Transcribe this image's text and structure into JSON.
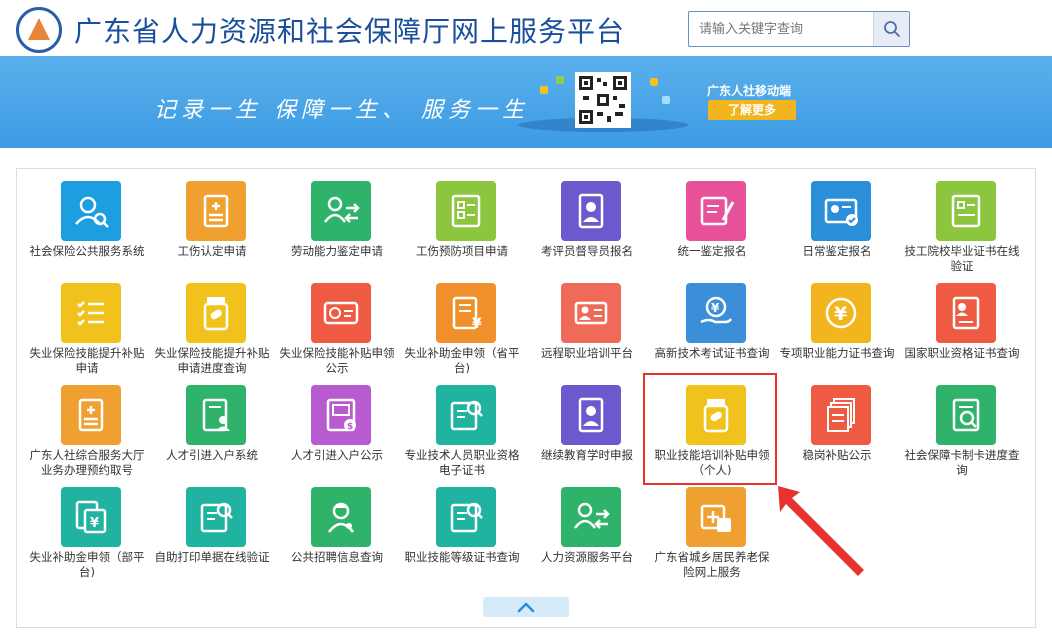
{
  "header": {
    "title": "广东省人力资源和社会保障厅网上服务平台",
    "search_placeholder": "请输入关键字查询"
  },
  "banner": {
    "slogan": "记录一生  保障一生、  服务一生",
    "mobile_label": "广东人社移动端",
    "more_button": "了解更多"
  },
  "colors": {
    "brand_blue": "#1a4f9c",
    "banner_blue": "#4aa4e8",
    "highlight_red": "#e8322d"
  },
  "tiles": [
    {
      "label": "社会保险公共服务系统",
      "color": "#1d9ee0",
      "icon": "user-search-icon"
    },
    {
      "label": "工伤认定申请",
      "color": "#f0a030",
      "icon": "document-plus-icon"
    },
    {
      "label": "劳动能力鉴定申请",
      "color": "#2fb36b",
      "icon": "users-transfer-icon"
    },
    {
      "label": "工伤预防项目申请",
      "color": "#8cc63f",
      "icon": "form-board-icon"
    },
    {
      "label": "考评员督导员报名",
      "color": "#6a5acd",
      "icon": "id-person-icon"
    },
    {
      "label": "统一鉴定报名",
      "color": "#e8509a",
      "icon": "edit-form-icon"
    },
    {
      "label": "日常鉴定报名",
      "color": "#2a8fd8",
      "icon": "id-card-check-icon"
    },
    {
      "label": "技工院校毕业证书在线验证",
      "color": "#8cc63f",
      "icon": "certificate-board-icon"
    },
    {
      "label": "失业保险技能提升补贴申请",
      "color": "#f2c21c",
      "icon": "checklist-icon"
    },
    {
      "label": "失业保险技能提升补贴申请进度查询",
      "color": "#f2c21c",
      "icon": "pill-bottle-icon"
    },
    {
      "label": "失业保险技能补贴申领公示",
      "color": "#ef5a42",
      "icon": "money-card-icon"
    },
    {
      "label": "失业补助金申领（省平台)",
      "color": "#f0902a",
      "icon": "yuan-document-icon"
    },
    {
      "label": "远程职业培训平台",
      "color": "#f06a5a",
      "icon": "person-card-icon"
    },
    {
      "label": "高新技术考试证书查询",
      "color": "#3a8fd8",
      "icon": "yuan-hand-icon"
    },
    {
      "label": "专项职业能力证书查询",
      "color": "#f2b51d",
      "icon": "yuan-coin-icon"
    },
    {
      "label": "国家职业资格证书查询",
      "color": "#ef5a42",
      "icon": "person-document-icon"
    },
    {
      "label": "广东人社综合服务大厅业务办理预约取号",
      "color": "#f0a030",
      "icon": "document-plus-icon"
    },
    {
      "label": "人才引进入户系统",
      "color": "#2fb36b",
      "icon": "person-doc-icon"
    },
    {
      "label": "人才引进入户公示",
      "color": "#b85ad0",
      "icon": "money-doc-icon"
    },
    {
      "label": "专业技术人员职业资格电子证书",
      "color": "#1fb3a0",
      "icon": "doc-search-icon"
    },
    {
      "label": "继续教育学时申报",
      "color": "#6a5acd",
      "icon": "id-person-icon"
    },
    {
      "label": "职业技能培训补贴申领（个人)",
      "color": "#f2c21c",
      "icon": "pill-bottle-icon"
    },
    {
      "label": "稳岗补贴公示",
      "color": "#ef5a42",
      "icon": "stack-documents-icon"
    },
    {
      "label": "社会保障卡制卡进度查询",
      "color": "#2fb36b",
      "icon": "doc-magnify-icon"
    },
    {
      "label": "失业补助金申领（部平台)",
      "color": "#1fb3a0",
      "icon": "yuan-copy-icon"
    },
    {
      "label": "自助打印单据在线验证",
      "color": "#1fb3a0",
      "icon": "doc-search-icon"
    },
    {
      "label": "公共招聘信息查询",
      "color": "#2fb36b",
      "icon": "worker-icon"
    },
    {
      "label": "职业技能等级证书查询",
      "color": "#1fb3a0",
      "icon": "doc-search-icon"
    },
    {
      "label": "人力资源服务平台",
      "color": "#2fb36b",
      "icon": "users-transfer-icon"
    },
    {
      "label": "广东省城乡居民养老保险网上服务",
      "color": "#f0a030",
      "icon": "medical-box-icon"
    }
  ]
}
